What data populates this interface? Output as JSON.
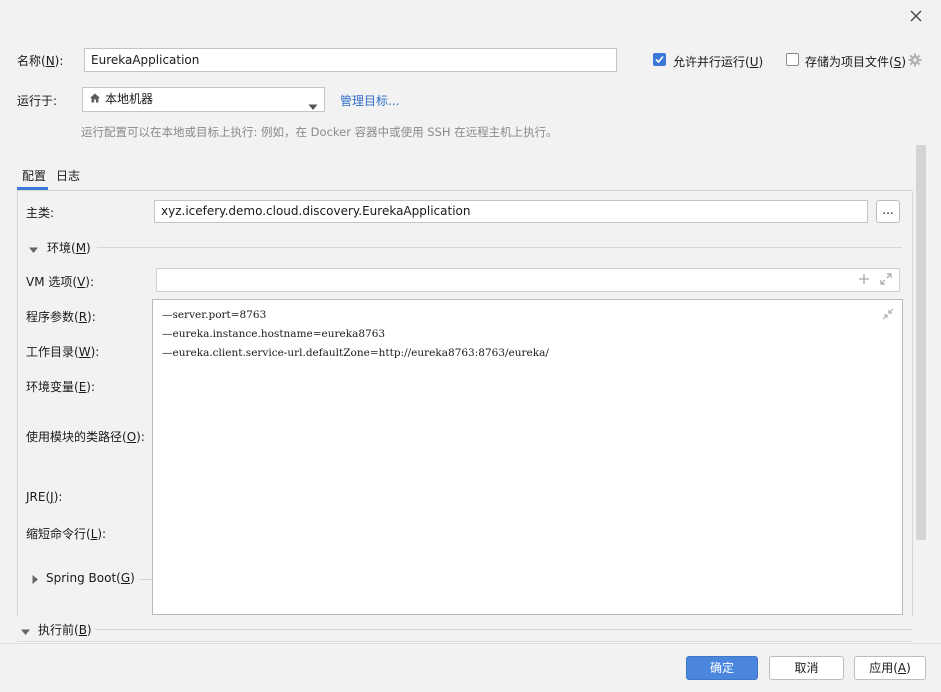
{
  "dialog": {
    "close_icon": "close-icon"
  },
  "header": {
    "name_label": "名称(",
    "name_key": "N",
    "name_label_end": "):",
    "name_value": "EurekaApplication",
    "allow_parallel_label": "允许并行运行(",
    "allow_parallel_key": "U",
    "allow_parallel_end": ")",
    "allow_parallel_checked": true,
    "store_as_file_label": "存储为项目文件(",
    "store_as_file_key": "S",
    "store_as_file_end": ")",
    "store_as_file_checked": false,
    "run_on_label": "运行于:",
    "run_on_value": "本地机器",
    "manage_targets_link": "管理目标...",
    "hint": "运行配置可以在本地或目标上执行: 例如，在 Docker 容器中或使用 SSH 在远程主机上执行。"
  },
  "tabs": [
    {
      "label": "配置",
      "active": true
    },
    {
      "label": "日志",
      "active": false
    }
  ],
  "config": {
    "main_class_label": "主类:",
    "main_class_value": "xyz.icefery.demo.cloud.discovery.EurekaApplication",
    "browse_button": "...",
    "env_section": "环境(",
    "env_section_key": "M",
    "env_section_end": ")",
    "vm_options_label": "VM 选项(",
    "vm_options_key": "V",
    "vm_options_end": "):",
    "program_args_label": "程序参数(",
    "program_args_key": "R",
    "program_args_end": "):",
    "working_dir_label": "工作目录(",
    "working_dir_key": "W",
    "working_dir_end": "):",
    "env_vars_label": "环境变量(",
    "env_vars_key": "E",
    "env_vars_end": "):",
    "module_classpath_label": "使用模块的类路径(",
    "module_classpath_key": "O",
    "module_classpath_end": "):",
    "jre_label": "JRE(",
    "jre_key": "J",
    "jre_end": "):",
    "shorten_cmd_label": "缩短命令行(",
    "shorten_cmd_key": "L",
    "shorten_cmd_end": "):",
    "spring_boot_section": "Spring Boot(",
    "spring_boot_key": "G",
    "spring_boot_end": ")",
    "program_args_lines": [
      "—server.port=8763",
      "—eureka.instance.hostname=eureka8763",
      "—eureka.client.service-url.defaultZone=http://eureka8763:8763/eureka/"
    ]
  },
  "before_launch": {
    "label": "执行前(",
    "key": "B",
    "end": ")"
  },
  "footer": {
    "ok": "确定",
    "cancel": "取消",
    "apply_label": "应用(",
    "apply_key": "A",
    "apply_end": ")"
  },
  "colors": {
    "accent": "#4a86dc",
    "link": "#2f6fc9",
    "checkbox_checked": "#3c79d6"
  }
}
